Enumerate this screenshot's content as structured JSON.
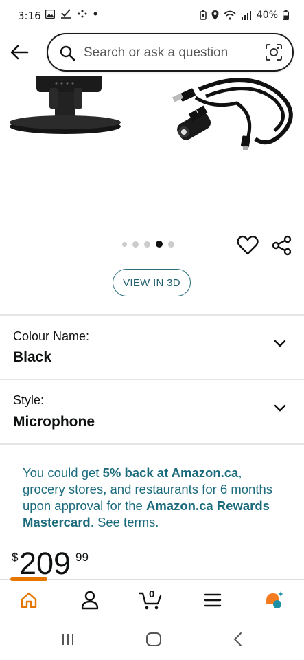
{
  "status_bar": {
    "time": "3:16",
    "battery": "40%"
  },
  "search": {
    "placeholder": "Search or ask a question"
  },
  "product_gallery": {
    "dot_count": 5,
    "active_index": 3
  },
  "view_3d": {
    "label": "VIEW IN 3D"
  },
  "options": [
    {
      "label": "Colour Name:",
      "value": "Black"
    },
    {
      "label": "Style:",
      "value": "Microphone"
    }
  ],
  "promo": {
    "part1": "You could get ",
    "bold1": "5% back at Amazon.ca",
    "part2": ", grocery stores, and restaurants for 6 months upon approval for the ",
    "bold2": "Amazon.ca Rewards Mastercard",
    "part3": ". See terms."
  },
  "price": {
    "currency": "$",
    "whole": "209",
    "fraction": "99"
  },
  "bottom_nav": {
    "cart_count": "0",
    "items": [
      "home-icon",
      "account-icon",
      "cart-icon",
      "menu-icon",
      "rufus-icon"
    ],
    "accent_color": "#e77600"
  },
  "colors": {
    "link": "#1b6b7d",
    "accent": "#e77600"
  }
}
